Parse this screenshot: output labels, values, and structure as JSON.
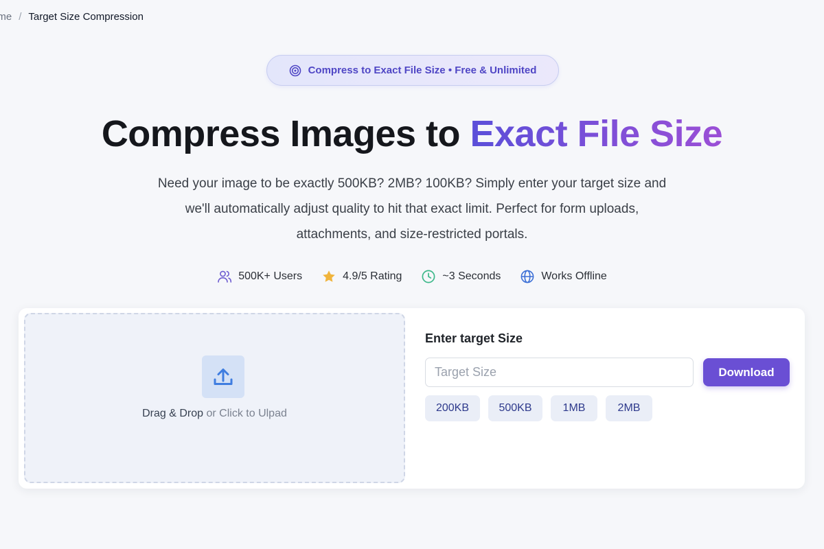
{
  "breadcrumb": {
    "home": "ome",
    "separator": "/",
    "current": "Target Size Compression"
  },
  "badge": {
    "icon": "target-icon",
    "text": "Compress to Exact File Size • Free & Unlimited"
  },
  "hero": {
    "title_plain": "Compress Images to ",
    "title_accent": "Exact File Size",
    "description_lines": [
      "Need your image to be exactly 500KB? 2MB? 100KB? Simply enter your target size and",
      "we'll automatically adjust quality to hit that exact limit. Perfect for form uploads,",
      "attachments, and size-restricted portals."
    ]
  },
  "stats": [
    {
      "icon": "users-icon",
      "label": "500K+ Users",
      "color": "#6d5bd0"
    },
    {
      "icon": "star-icon",
      "label": "4.9/5 Rating",
      "color": "#f0b43c"
    },
    {
      "icon": "clock-icon",
      "label": "~3 Seconds",
      "color": "#3db88a"
    },
    {
      "icon": "globe-icon",
      "label": "Works Offline",
      "color": "#3b6fd6"
    }
  ],
  "upload": {
    "icon": "upload-icon",
    "text_strong": "Drag & Drop",
    "text_muted": " or Click to Ulpad"
  },
  "target": {
    "title": "Enter target Size",
    "placeholder": "Target Size",
    "value": "",
    "download_label": "Download",
    "presets": [
      "200KB",
      "500KB",
      "1MB",
      "2MB"
    ]
  },
  "colors": {
    "accent": "#6a4fd4",
    "accent_gradient_start": "#5b4fd9",
    "accent_gradient_end": "#9b4fd6",
    "background": "#f6f7fa"
  }
}
